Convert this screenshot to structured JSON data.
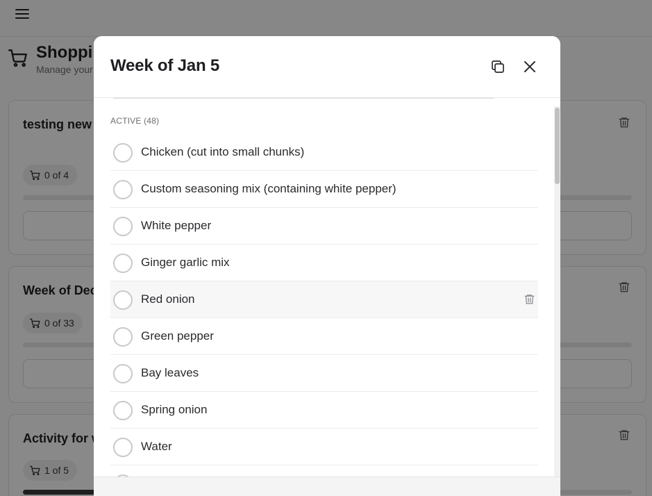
{
  "app": {
    "page_title": "Shopping Lists",
    "page_subtitle": "Manage your shopping lists"
  },
  "icons": {
    "menu": "hamburger-menu-icon",
    "cart": "shopping-cart-icon",
    "trash": "trash-icon",
    "copy": "copy-icon",
    "close": "close-icon"
  },
  "background_cards": [
    {
      "title": "testing new shopping list with a long ingredient",
      "badge": "0 of 4",
      "progress": 0
    },
    {
      "title": "Week of Dec",
      "badge": "0 of 33",
      "progress": 0
    },
    {
      "title": "Activity for w",
      "badge": "1 of 5",
      "progress": 0.2
    }
  ],
  "modal": {
    "title": "Week of Jan 5",
    "section_label": "ACTIVE (48)",
    "items": [
      {
        "label": "Chicken (cut into small chunks)"
      },
      {
        "label": "Custom seasoning mix (containing white pepper)"
      },
      {
        "label": "White pepper"
      },
      {
        "label": "Ginger garlic mix"
      },
      {
        "label": "Red onion"
      },
      {
        "label": "Green pepper"
      },
      {
        "label": "Bay leaves"
      },
      {
        "label": "Spring onion"
      },
      {
        "label": "Water"
      }
    ]
  },
  "colors": {
    "overlay": "#000000",
    "accent_text": "#1f1f23",
    "muted_text": "#6b6b70"
  }
}
